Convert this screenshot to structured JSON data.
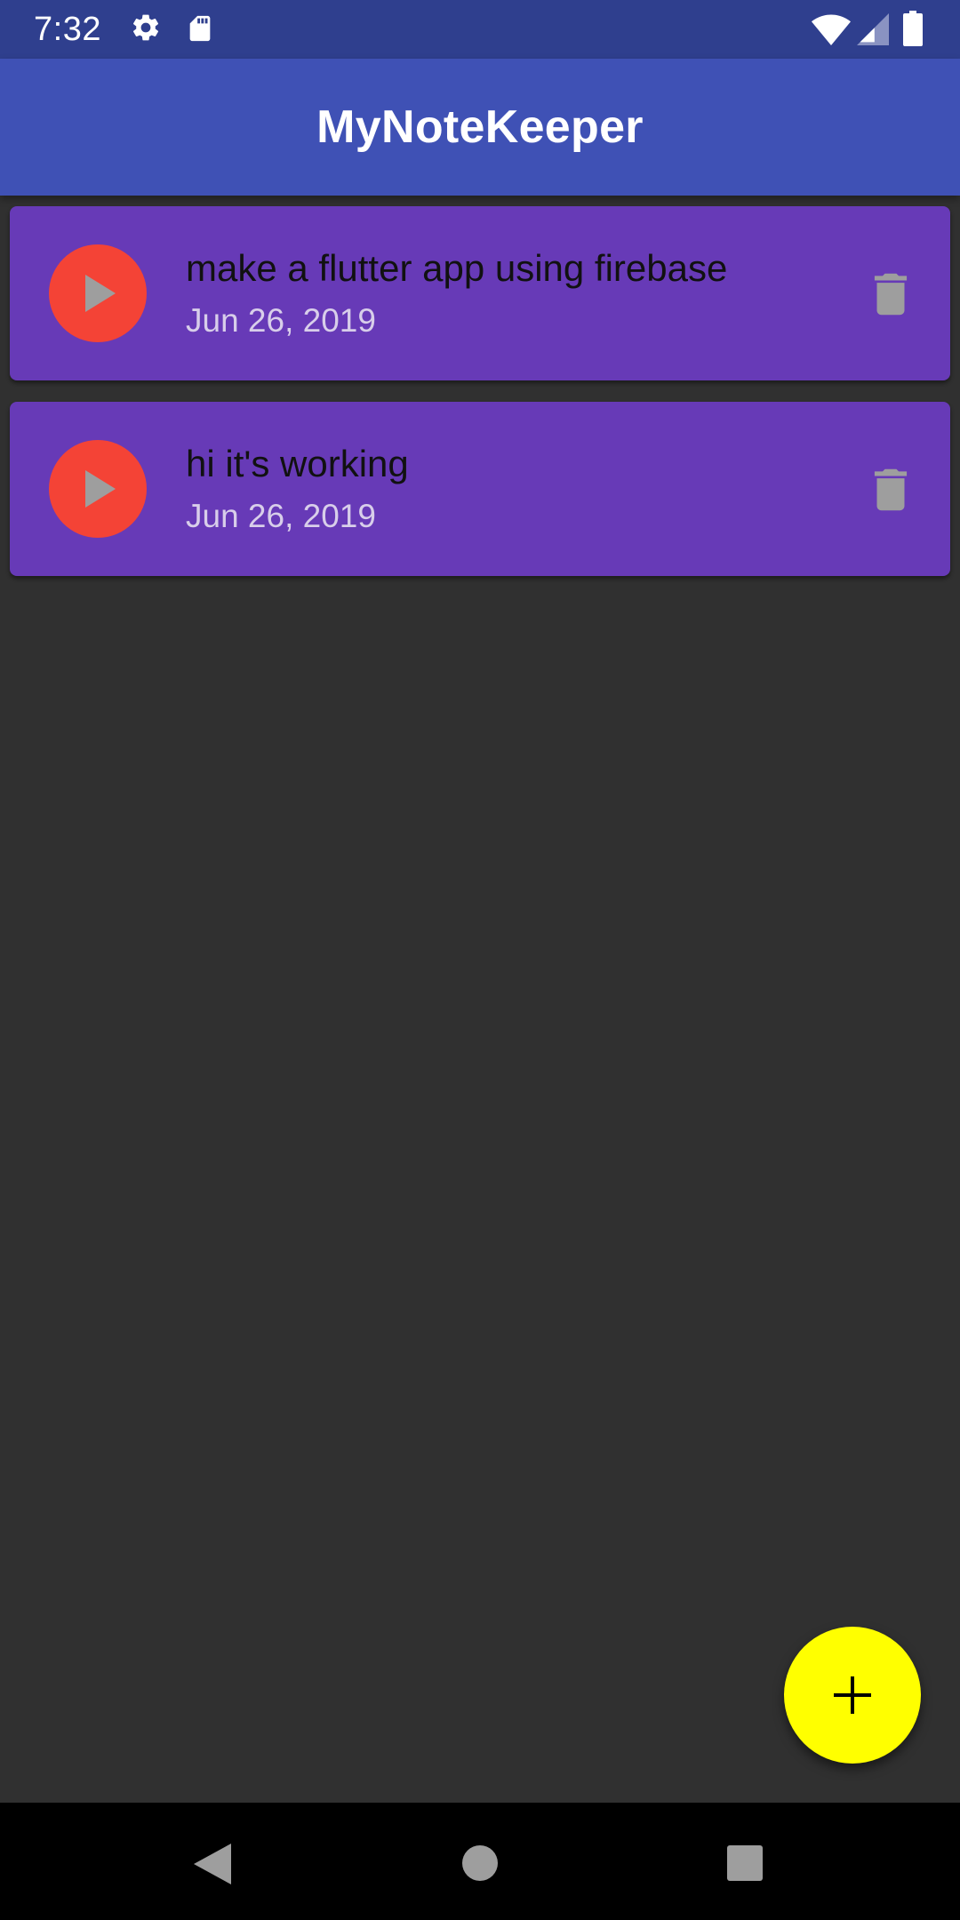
{
  "status_bar": {
    "time": "7:32",
    "icons": [
      "gear-icon",
      "sd-card-icon",
      "wifi-icon",
      "signal-icon",
      "battery-icon"
    ]
  },
  "app_bar": {
    "title": "MyNoteKeeper"
  },
  "notes": [
    {
      "title": "make a flutter app using firebase",
      "date": "Jun 26, 2019"
    },
    {
      "title": "hi it's working",
      "date": "Jun 26, 2019"
    }
  ],
  "fab": {
    "icon": "add-icon"
  },
  "nav_bar": {
    "icons": [
      "back-icon",
      "home-icon",
      "recents-icon"
    ]
  },
  "colors": {
    "status_bar": "#2f3f8e",
    "app_bar": "#3f51b5",
    "background": "#303030",
    "card": "#673ab7",
    "avatar": "#f44336",
    "fab": "#ffff00",
    "icon_grey": "#9e9e9e"
  }
}
